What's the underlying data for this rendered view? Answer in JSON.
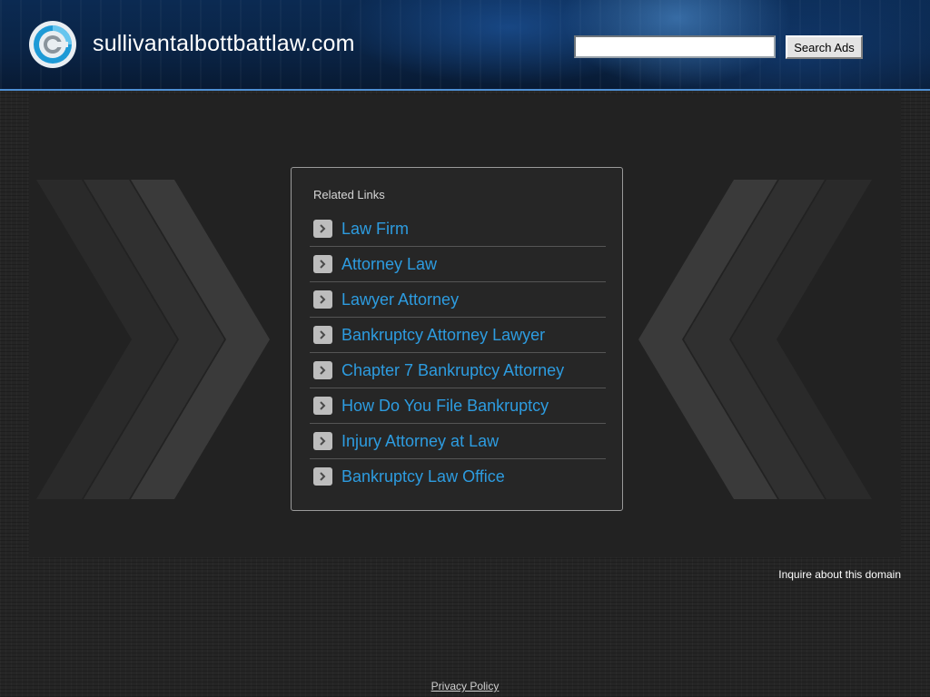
{
  "header": {
    "site_title": "sullivantalbottbattlaw.com",
    "search_placeholder": "",
    "search_value": "",
    "search_button_label": "Search Ads",
    "logo_icon": "domain-logo-icon"
  },
  "related_links": {
    "title": "Related Links",
    "items": [
      {
        "label": "Law Firm"
      },
      {
        "label": "Attorney Law"
      },
      {
        "label": "Lawyer Attorney"
      },
      {
        "label": "Bankruptcy Attorney Lawyer"
      },
      {
        "label": "Chapter 7 Bankruptcy Attorney"
      },
      {
        "label": "How Do You File Bankruptcy"
      },
      {
        "label": "Injury Attorney at Law"
      },
      {
        "label": "Bankruptcy Law Office"
      }
    ]
  },
  "footer": {
    "inquire_label": "Inquire about this domain",
    "privacy_label": "Privacy Policy"
  },
  "colors": {
    "link": "#2d9ce0",
    "header_accent": "#4d8fd4",
    "background": "#252525"
  }
}
